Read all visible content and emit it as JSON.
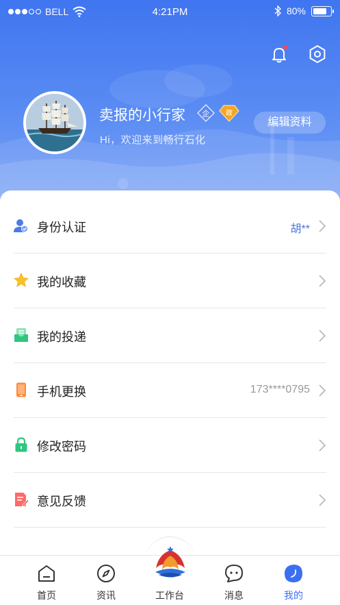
{
  "status_bar": {
    "carrier": "BELL",
    "time": "4:21PM",
    "battery": "80%"
  },
  "profile": {
    "nickname": "卖报的小行家",
    "tag_enterprise": "企",
    "tag_gov": "政",
    "welcome": "Hi，欢迎来到畅行石化",
    "edit_label": "编辑资料"
  },
  "menu": {
    "items": [
      {
        "label": "身份认证",
        "value": "胡**",
        "icon": "id-verify-icon"
      },
      {
        "label": "我的收藏",
        "value": "",
        "icon": "star-icon"
      },
      {
        "label": "我的投递",
        "value": "",
        "icon": "delivery-icon"
      },
      {
        "label": "手机更换",
        "value": "173****0795",
        "icon": "phone-icon"
      },
      {
        "label": "修改密码",
        "value": "",
        "icon": "lock-icon"
      },
      {
        "label": "意见反馈",
        "value": "",
        "icon": "feedback-icon"
      }
    ]
  },
  "tabbar": {
    "home": "首页",
    "news": "资讯",
    "workbench": "工作台",
    "messages": "消息",
    "mine": "我的"
  },
  "colors": {
    "primary": "#3c6ff0",
    "header_top": "#3f75f0",
    "badge_red": "#ff4a4a"
  }
}
